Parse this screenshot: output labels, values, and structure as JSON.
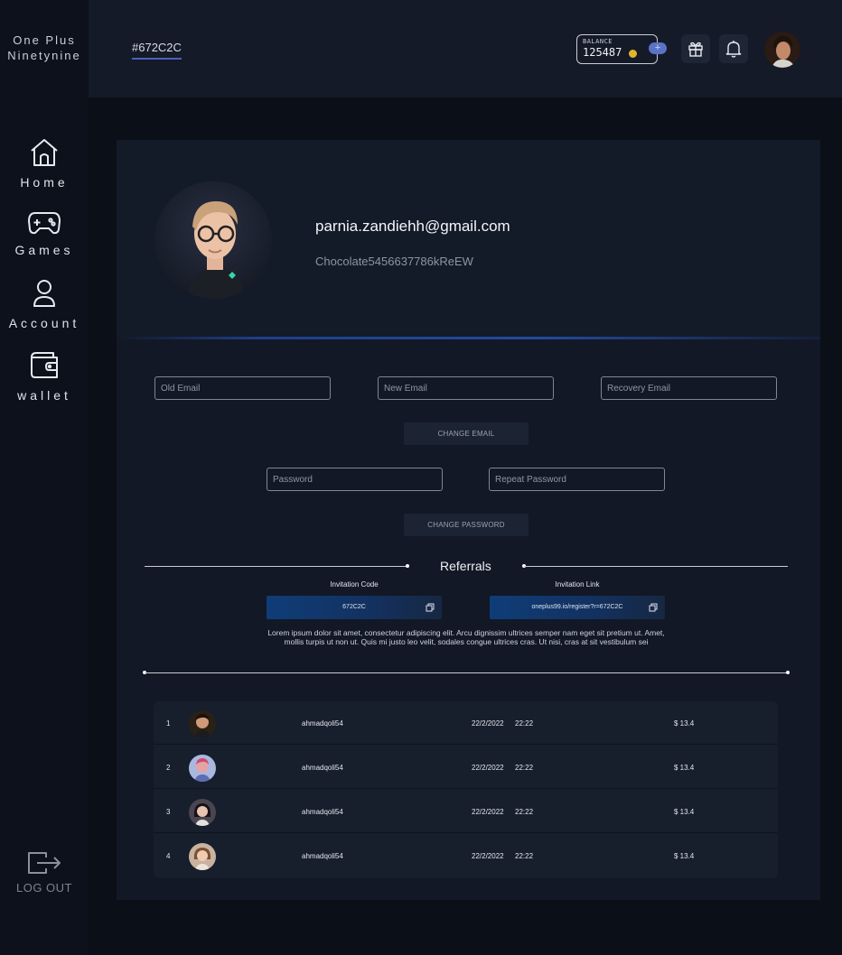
{
  "brand": {
    "line1": "One Plus",
    "line2": "Ninetynine"
  },
  "sidebar": {
    "items": [
      {
        "label": "Home",
        "icon": "home-icon"
      },
      {
        "label": "Games",
        "icon": "gamepad-icon"
      },
      {
        "label": "Account",
        "icon": "user-icon"
      },
      {
        "label": "wallet",
        "icon": "wallet-icon"
      }
    ],
    "logout_label": "LOG OUT"
  },
  "header": {
    "code": "#672C2C",
    "balance_label": "BALANCE",
    "balance_value": "125487",
    "add_label": "+"
  },
  "profile": {
    "email": "parnia.zandiehh@gmail.com",
    "password": "Chocolate5456637786kReEW"
  },
  "forms": {
    "old_email_placeholder": "Old Email",
    "new_email_placeholder": "New Email",
    "recovery_email_placeholder": "Recovery Email",
    "change_email_label": "CHANGE EMAIL",
    "password_placeholder": "Password",
    "repeat_password_placeholder": "Repeat Password",
    "change_password_label": "CHANGE PASSWORD"
  },
  "referrals": {
    "title": "Referrals",
    "invitation_code_label": "Invitation Code",
    "invitation_code": "672C2C",
    "invitation_link_label": "Invitation Link",
    "invitation_link": "oneplus99.io/register?r=672C2C",
    "description": "Lorem ipsum dolor sit amet, consectetur adipiscing elit. Arcu dignissim ultrices semper nam eget sit pretium ut. Amet, mollis turpis ut non ut. Quis mi justo leo velit, sodales congue ultrices cras. Ut nisi, cras at sit vestibulum sei"
  },
  "table": {
    "rows": [
      {
        "rank": "1",
        "username": "ahmadqoli54",
        "date": "22/2/2022",
        "time": "22:22",
        "amount": "$ 13.4"
      },
      {
        "rank": "2",
        "username": "ahmadqoli54",
        "date": "22/2/2022",
        "time": "22:22",
        "amount": "$ 13.4"
      },
      {
        "rank": "3",
        "username": "ahmadqoli54",
        "date": "22/2/2022",
        "time": "22:22",
        "amount": "$ 13.4"
      },
      {
        "rank": "4",
        "username": "ahmadqoli54",
        "date": "22/2/2022",
        "time": "22:22",
        "amount": "$ 13.4"
      }
    ]
  },
  "colors": {
    "background": "#0b0f18",
    "panel": "#121826",
    "accent": "#4f5fb8",
    "coin": "#e1b52c"
  }
}
